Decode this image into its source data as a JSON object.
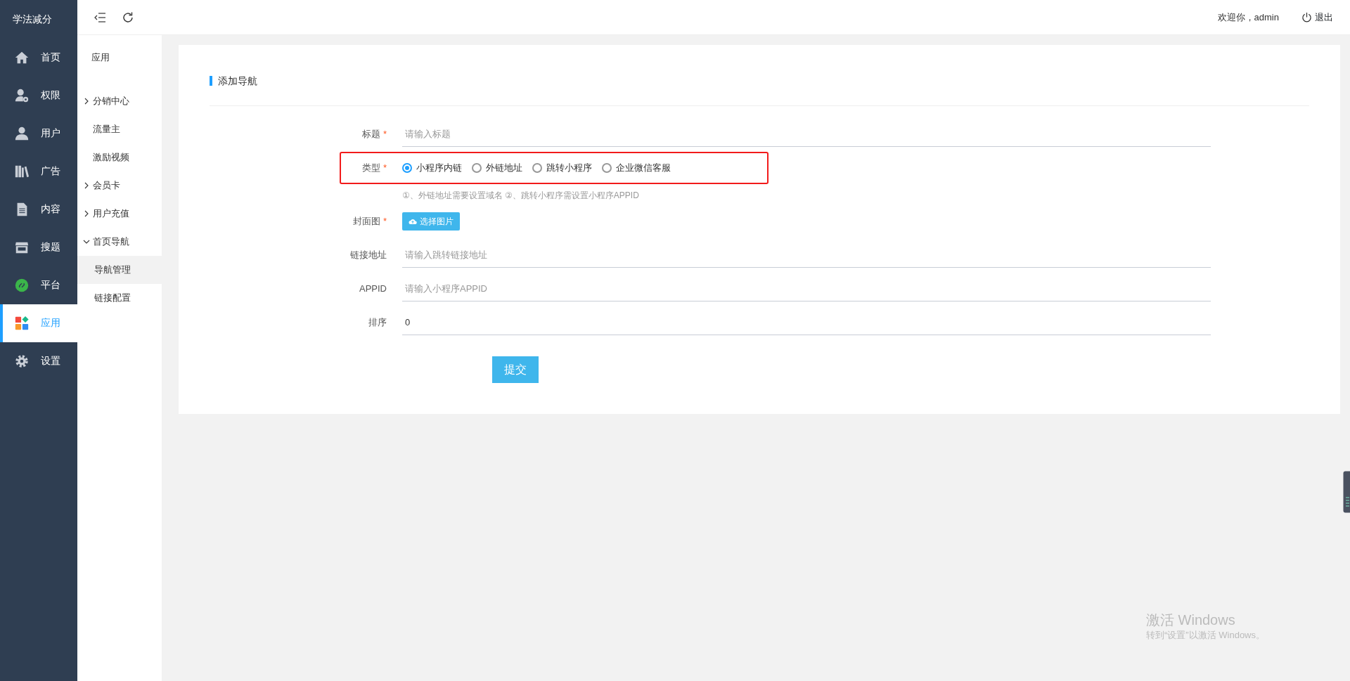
{
  "app": {
    "logo": "学法减分"
  },
  "nav": [
    {
      "label": "首页",
      "selected": false
    },
    {
      "label": "权限",
      "selected": false
    },
    {
      "label": "用户",
      "selected": false
    },
    {
      "label": "广告",
      "selected": false
    },
    {
      "label": "内容",
      "selected": false
    },
    {
      "label": "搜题",
      "selected": false
    },
    {
      "label": "平台",
      "selected": false
    },
    {
      "label": "应用",
      "selected": true
    },
    {
      "label": "设置",
      "selected": false
    }
  ],
  "toolbar": {
    "welcome": "欢迎你，admin",
    "logout": "退出"
  },
  "subnav": {
    "title": "应用",
    "items": [
      {
        "kind": "group",
        "label": "分销中心",
        "expanded": false
      },
      {
        "kind": "link",
        "label": "流量主",
        "selected": false
      },
      {
        "kind": "link",
        "label": "激励视频",
        "selected": false
      },
      {
        "kind": "group",
        "label": "会员卡",
        "expanded": false
      },
      {
        "kind": "group",
        "label": "用户充值",
        "expanded": false
      },
      {
        "kind": "group",
        "label": "首页导航",
        "expanded": true,
        "children": [
          {
            "kind": "link",
            "label": "导航管理",
            "selected": true
          },
          {
            "kind": "link",
            "label": "链接配置",
            "selected": false
          }
        ]
      }
    ]
  },
  "form": {
    "title": "添加导航",
    "fields": [
      {
        "kind": "text",
        "label": "标题",
        "required_mark": "*",
        "placeholder": "请输入标题"
      },
      {
        "kind": "radio",
        "label": "类型",
        "required_mark": "*",
        "highlighted": true,
        "options": [
          {
            "label": "小程序内链",
            "selected": true
          },
          {
            "label": "外链地址",
            "selected": false
          },
          {
            "label": "跳转小程序",
            "selected": false
          },
          {
            "label": "企业微信客服",
            "selected": false
          }
        ],
        "hint": "①、外链地址需要设置域名 ②、跳转小程序需设置小程序APPID"
      },
      {
        "kind": "upload",
        "label": "封面图",
        "required_mark": "*",
        "button": "选择图片"
      },
      {
        "kind": "text",
        "label": "链接地址",
        "placeholder": "请输入跳转链接地址"
      },
      {
        "kind": "text",
        "label": "APPID",
        "placeholder": "请输入小程序APPID"
      },
      {
        "kind": "text",
        "label": "排序",
        "value": "0"
      }
    ],
    "submit": "提交"
  },
  "os_notice": {
    "title": "激活 Windows",
    "subtitle": "转到“设置”以激活 Windows。"
  }
}
